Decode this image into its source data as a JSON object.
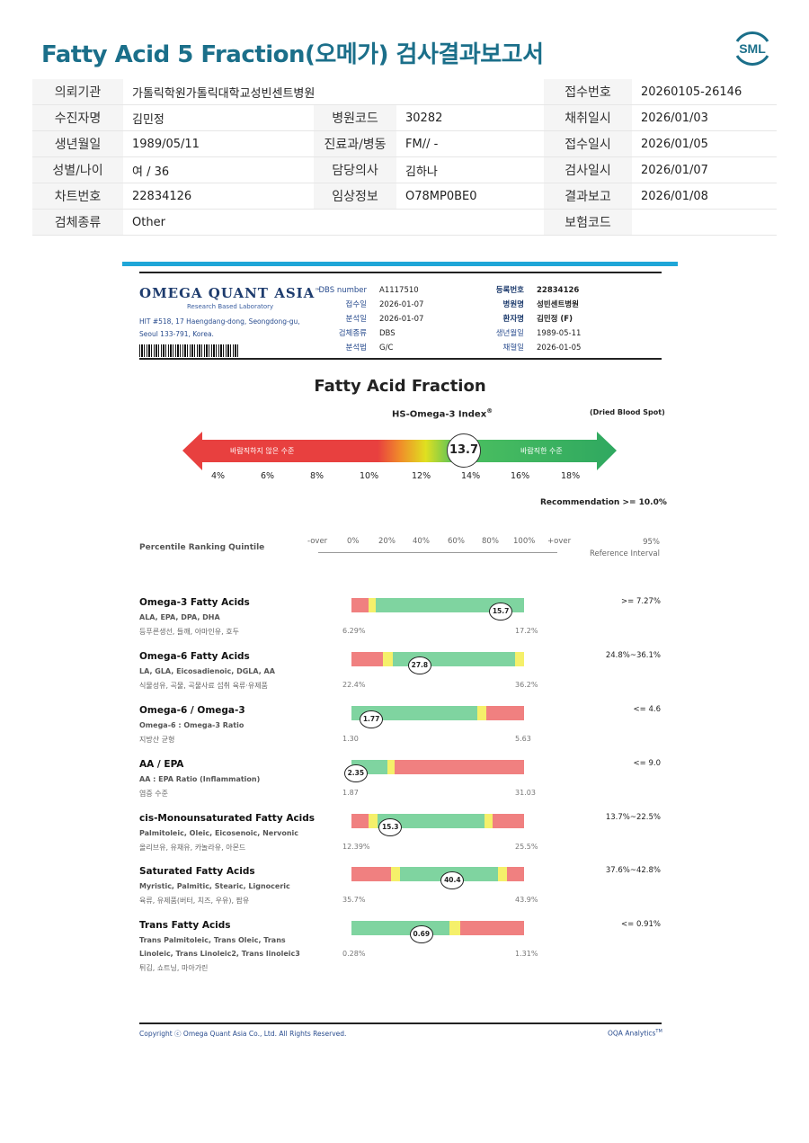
{
  "header": {
    "title": "Fatty Acid 5 Fraction(오메가) 검사결과보고서",
    "logo_text": "SML"
  },
  "patient_info": {
    "rows": [
      [
        {
          "label": "의뢰기관",
          "value": "가톨릭학원가톨릭대학교성빈센트병원"
        },
        {
          "label": "접수번호",
          "value": "20260105-26146"
        }
      ],
      [
        {
          "label": "수진자명",
          "value": "김민정"
        },
        {
          "label": "병원코드",
          "value": "30282"
        },
        {
          "label": "채취일시",
          "value": "2026/01/03"
        }
      ],
      [
        {
          "label": "생년월일",
          "value": "1989/05/11"
        },
        {
          "label": "진료과/병동",
          "value": "FM// -"
        },
        {
          "label": "접수일시",
          "value": "2026/01/05"
        }
      ],
      [
        {
          "label": "성별/나이",
          "value": "여 / 36"
        },
        {
          "label": "담당의사",
          "value": "김하나"
        },
        {
          "label": "검사일시",
          "value": "2026/01/07"
        }
      ],
      [
        {
          "label": "차트번호",
          "value": "22834126"
        },
        {
          "label": "임상정보",
          "value": "O78MP0BE0"
        },
        {
          "label": "결과보고",
          "value": "2026/01/08"
        }
      ],
      [
        {
          "label": "검체종류",
          "value": "Other"
        },
        {
          "label": "보험코드",
          "value": ""
        }
      ]
    ]
  },
  "report": {
    "lab_name": "OMEGA QUANT ASIA",
    "lab_tm": "™",
    "lab_sub": "Research Based Laboratory",
    "address_1": "HIT #518, 17 Haengdang-dong, Seongdong-gu,",
    "address_2": "Seoul 133-791, Korea.",
    "meta_left": [
      {
        "k": "DBS number",
        "v": "A1117510"
      },
      {
        "k": "접수일",
        "v": "2026-01-07"
      },
      {
        "k": "분석일",
        "v": "2026-01-07"
      },
      {
        "k": "검체종류",
        "v": "DBS"
      },
      {
        "k": "분석법",
        "v": "G/C"
      }
    ],
    "meta_right": [
      {
        "k": "등록번호",
        "v": "22834126"
      },
      {
        "k": "병원명",
        "v": "성빈센트병원"
      },
      {
        "k": "환자명",
        "v": "김민정 (F)"
      },
      {
        "k": "생년월일",
        "v": "1989-05-11"
      },
      {
        "k": "채혈일",
        "v": "2026-01-05"
      }
    ],
    "section_title": "Fatty Acid Fraction",
    "index_title": "HS-Omega-3 Index",
    "index_reg": "®",
    "sample_type": "(Dried Blood Spot)",
    "index_value": "13.7",
    "undesired_label": "바람직하지 않은 수준",
    "desired_label": "바람직한 수준",
    "index_ticks": [
      "4%",
      "6%",
      "8%",
      "10%",
      "12%",
      "14%",
      "16%",
      "18%"
    ],
    "recommendation": "Recommendation  >= 10.0%",
    "quintile_label": "Percentile Ranking Quintile",
    "scale_labels": [
      "-over",
      "0%",
      "20%",
      "40%",
      "60%",
      "80%",
      "100%",
      "+over"
    ],
    "ref_interval_1": "95%",
    "ref_interval_2": "Reference Interval",
    "copyright": "Copyright ⓒ Omega Quant Asia Co., Ltd.  All Rights Reserved.",
    "analytics": "OQA Analytics",
    "analytics_tm": "TM"
  },
  "colors": {
    "red": "#f08080",
    "yellow": "#f5f06a",
    "green": "#7fd4a0",
    "brand": "#1b6f8a",
    "accent": "#1fa6d8"
  },
  "fractions": [
    {
      "name": "Omega-3 Fatty Acids",
      "sub": "ALA, EPA, DPA, DHA",
      "kr": "등푸른생선, 들깨, 아마인유, 호두",
      "ref": ">= 7.27%",
      "low": "6.29%",
      "high": "17.2%",
      "value": "15.7",
      "position": 0.86,
      "segments": [
        [
          "red",
          0.1
        ],
        [
          "yellow",
          0.04
        ],
        [
          "green",
          0.86
        ]
      ]
    },
    {
      "name": "Omega-6 Fatty Acids",
      "sub": "LA, GLA, Eicosadienoic, DGLA, AA",
      "kr": "식물성유, 곡물, 곡물사료 섭취 육류·유제품",
      "ref": "24.8%~36.1%",
      "low": "22.4%",
      "high": "36.2%",
      "value": "27.8",
      "position": 0.39,
      "segments": [
        [
          "red",
          0.18
        ],
        [
          "yellow",
          0.06
        ],
        [
          "green",
          0.71
        ],
        [
          "yellow",
          0.05
        ]
      ]
    },
    {
      "name": "Omega-6 / Omega-3",
      "sub": "Omega-6 : Omega-3 Ratio",
      "kr": "지방산 균형",
      "ref": "<= 4.6",
      "low": "1.30",
      "high": "5.63",
      "value": "1.77",
      "position": 0.11,
      "segments": [
        [
          "green",
          0.73
        ],
        [
          "yellow",
          0.05
        ],
        [
          "red",
          0.22
        ]
      ]
    },
    {
      "name": "AA / EPA",
      "sub": "AA : EPA Ratio (Inflammation)",
      "kr": "염증 수준",
      "ref": "<= 9.0",
      "low": "1.87",
      "high": "31.03",
      "value": "2.35",
      "position": 0.02,
      "segments": [
        [
          "green",
          0.21
        ],
        [
          "yellow",
          0.04
        ],
        [
          "red",
          0.75
        ]
      ]
    },
    {
      "name": "cis-Monounsaturated Fatty Acids",
      "sub": "Palmitoleic, Oleic, Eicosenoic, Nervonic",
      "kr": "올리브유, 유채유, 카놀라유, 아몬드",
      "ref": "13.7%~22.5%",
      "low": "12.39%",
      "high": "25.5%",
      "value": "15.3",
      "position": 0.22,
      "segments": [
        [
          "red",
          0.1
        ],
        [
          "yellow",
          0.05
        ],
        [
          "green",
          0.62
        ],
        [
          "yellow",
          0.05
        ],
        [
          "red",
          0.18
        ]
      ]
    },
    {
      "name": "Saturated Fatty Acids",
      "sub": "Myristic, Palmitic, Stearic, Lignoceric",
      "kr": "육류, 유제품(버터, 치즈, 우유), 팜유",
      "ref": "37.6%~42.8%",
      "low": "35.7%",
      "high": "43.9%",
      "value": "40.4",
      "position": 0.58,
      "segments": [
        [
          "red",
          0.23
        ],
        [
          "yellow",
          0.05
        ],
        [
          "green",
          0.57
        ],
        [
          "yellow",
          0.05
        ],
        [
          "red",
          0.1
        ]
      ]
    },
    {
      "name": "Trans Fatty Acids",
      "sub": "Trans Palmitoleic, Trans Oleic, Trans",
      "sub2": "Linoleic, Trans Linoleic2, Trans linoleic3",
      "kr": "튀김, 쇼트닝, 마아가린",
      "ref": "<= 0.91%",
      "low": "0.28%",
      "high": "1.31%",
      "value": "0.69",
      "position": 0.4,
      "segments": [
        [
          "green",
          0.57
        ],
        [
          "yellow",
          0.06
        ],
        [
          "red",
          0.37
        ]
      ]
    }
  ]
}
